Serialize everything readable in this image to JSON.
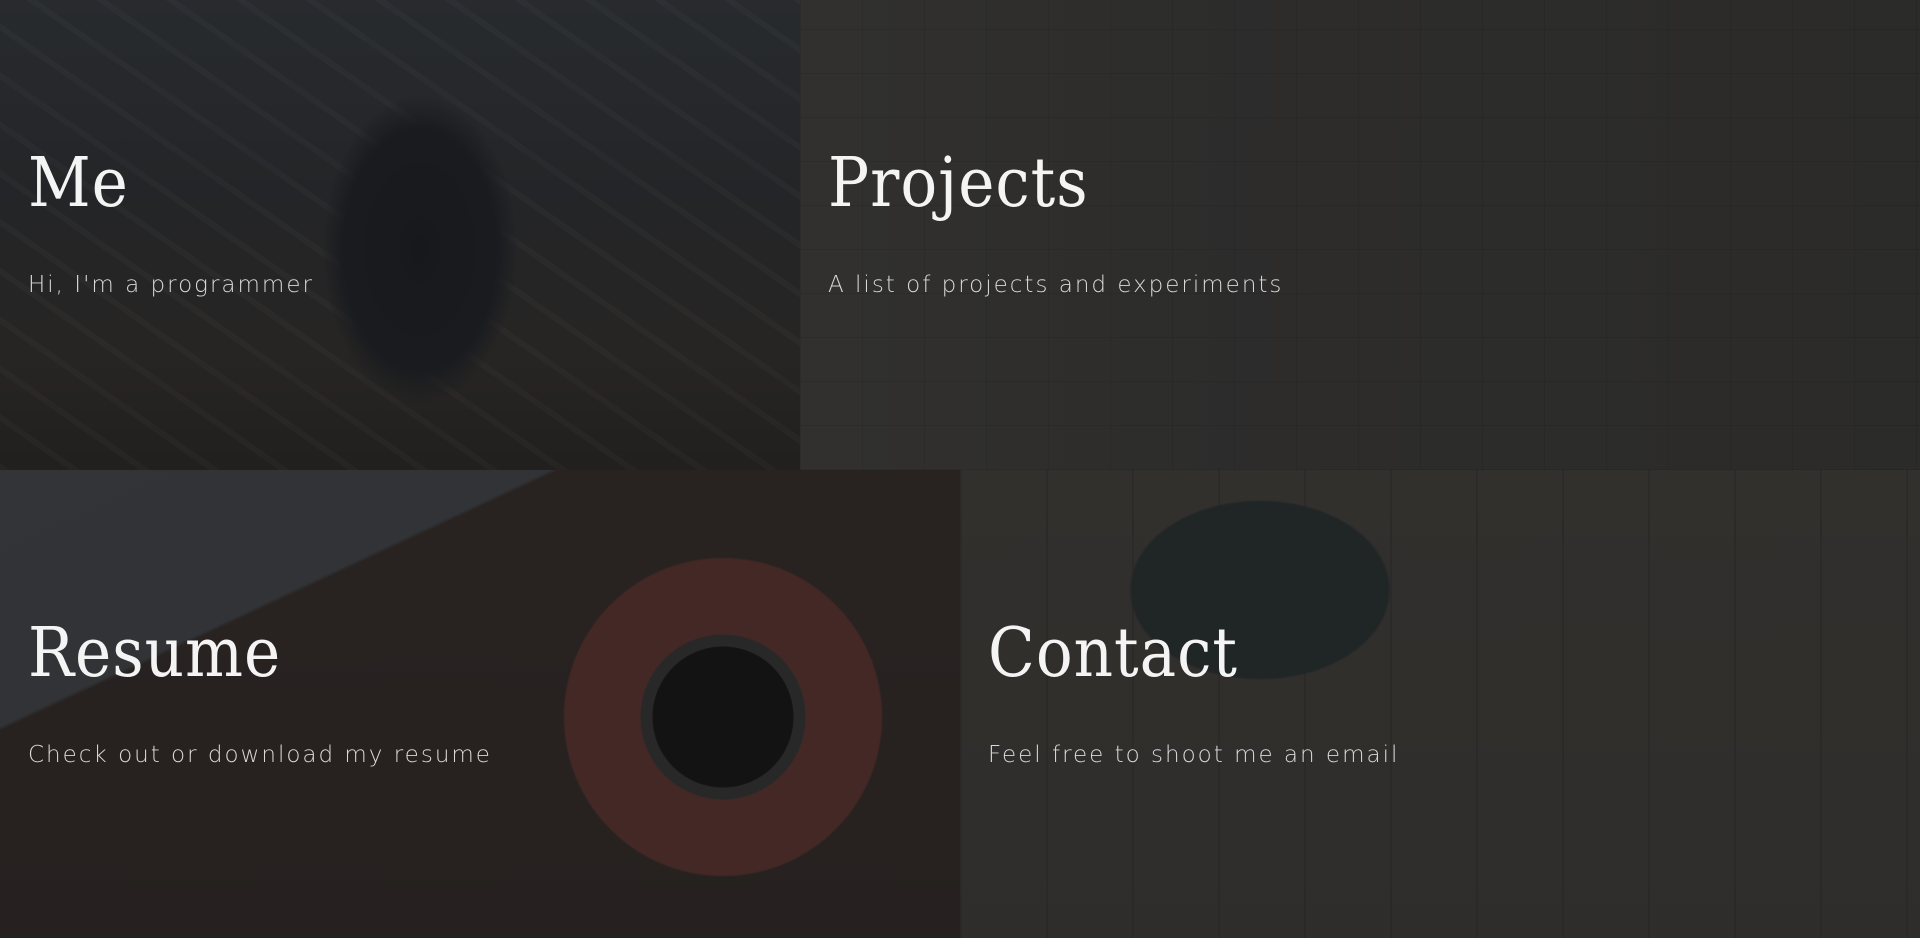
{
  "tiles": [
    {
      "title": "Me",
      "subtitle": "Hi, I'm a programmer"
    },
    {
      "title": "Projects",
      "subtitle": "A list of projects and experiments"
    },
    {
      "title": "Resume",
      "subtitle": "Check out or download my resume"
    },
    {
      "title": "Contact",
      "subtitle": "Feel free to shoot me an email"
    }
  ],
  "colors": {
    "text": "#f4f4f4",
    "subtext": "#d9d9d9",
    "overlay": "#141414"
  }
}
